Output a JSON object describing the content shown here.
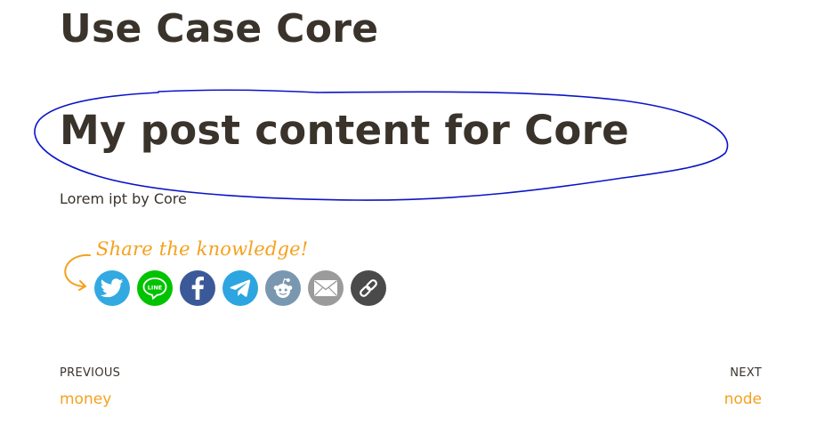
{
  "site": {
    "title": "Use Case Core"
  },
  "post": {
    "title": "My post content for Core",
    "body": "Lorem ipt by Core"
  },
  "annotation": {
    "color": "#0a14c8",
    "shape": "hand-drawn-ellipse-around-post-title"
  },
  "share": {
    "label": "Share the knowledge!",
    "label_color": "#f5a11d",
    "buttons": [
      {
        "name": "twitter",
        "icon": "twitter-bird-icon",
        "color": "#32a9e1"
      },
      {
        "name": "line",
        "icon": "line-chat-icon",
        "color": "#00c300",
        "text": "LINE"
      },
      {
        "name": "facebook",
        "icon": "facebook-f-icon",
        "color": "#3b5998"
      },
      {
        "name": "telegram",
        "icon": "telegram-plane-icon",
        "color": "#2ca5e0"
      },
      {
        "name": "reddit",
        "icon": "reddit-alien-icon",
        "color": "#7a97b0"
      },
      {
        "name": "email",
        "icon": "envelope-icon",
        "color": "#9b9b9b"
      },
      {
        "name": "copy-link",
        "icon": "chain-link-icon",
        "color": "#4a4a4a"
      }
    ]
  },
  "navigation": {
    "previous": {
      "meta": "PREVIOUS",
      "title": "money"
    },
    "next": {
      "meta": "NEXT",
      "title": "node"
    }
  },
  "colors": {
    "heading": "#3a332b",
    "accent": "#f5a11d"
  }
}
